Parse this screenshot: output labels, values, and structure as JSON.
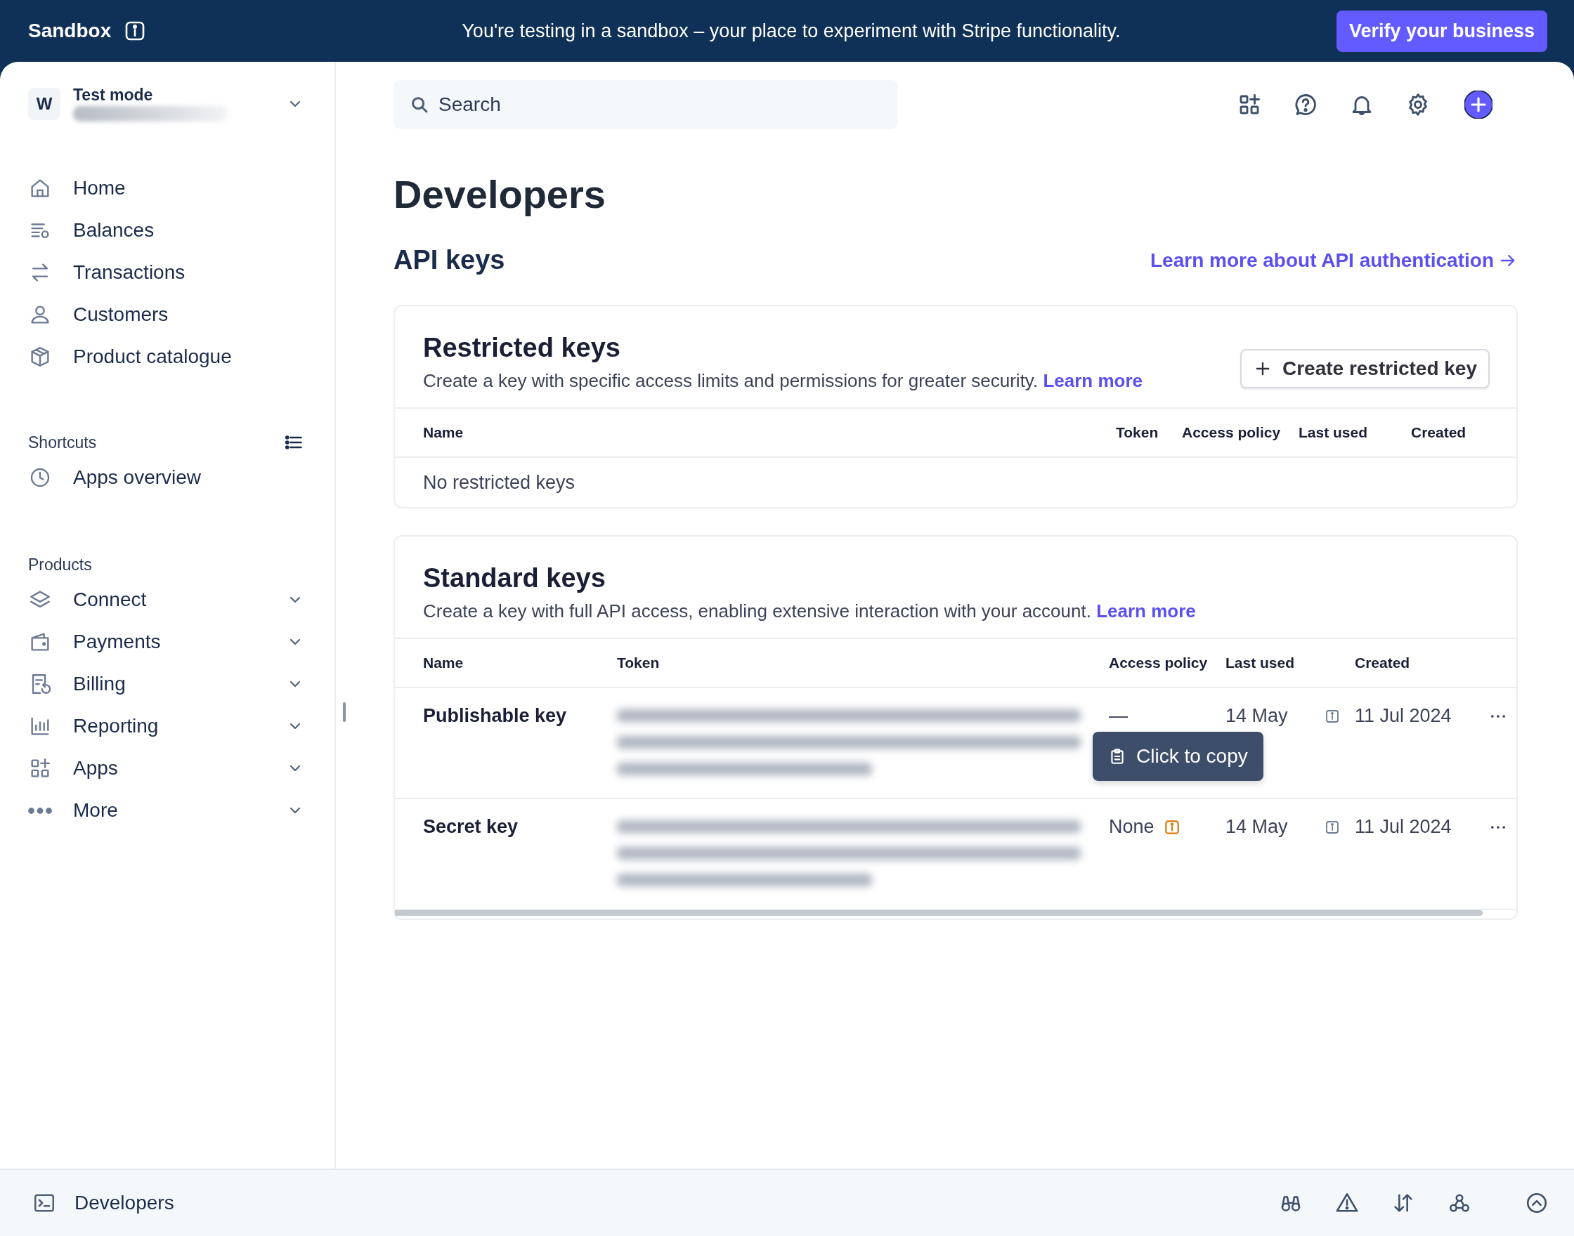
{
  "banner": {
    "label": "Sandbox",
    "message": "You're testing in a sandbox – your place to experiment with Stripe functionality.",
    "button": "Verify your business"
  },
  "account": {
    "avatar": "W",
    "mode": "Test mode"
  },
  "nav": {
    "items": [
      {
        "label": "Home"
      },
      {
        "label": "Balances"
      },
      {
        "label": "Transactions"
      },
      {
        "label": "Customers"
      },
      {
        "label": "Product catalogue"
      }
    ]
  },
  "shortcuts": {
    "heading": "Shortcuts",
    "items": [
      {
        "label": "Apps overview"
      }
    ]
  },
  "products": {
    "heading": "Products",
    "items": [
      {
        "label": "Connect",
        "expanded": false
      },
      {
        "label": "Payments",
        "expanded": false
      },
      {
        "label": "Billing",
        "expanded": false
      },
      {
        "label": "Reporting",
        "expanded": false
      },
      {
        "label": "Apps",
        "expanded": false
      },
      {
        "label": "More",
        "expanded": false
      }
    ]
  },
  "search": {
    "placeholder": "Search"
  },
  "page_title": "Developers",
  "section": {
    "title": "API keys",
    "link": "Learn more about API authentication"
  },
  "restricted": {
    "title": "Restricted keys",
    "description": "Create a key with specific access limits and permissions for greater security.",
    "link": "Learn more",
    "button": "Create restricted key",
    "columns": [
      "Name",
      "Token",
      "Access policy",
      "Last used",
      "Created"
    ],
    "empty_text": "No restricted keys"
  },
  "standard": {
    "title": "Standard keys",
    "description": "Create a key with full API access, enabling extensive interaction with your account.",
    "link": "Learn more",
    "columns": [
      "Name",
      "Token",
      "Access policy",
      "Last used",
      "Created"
    ],
    "rows": [
      {
        "name": "Publishable key",
        "access_policy": "—",
        "policy_warning": false,
        "last_used": "14 May",
        "created": "11 Jul 2024"
      },
      {
        "name": "Secret key",
        "access_policy": "None",
        "policy_warning": true,
        "last_used": "14 May",
        "created": "11 Jul 2024"
      }
    ],
    "tooltip": "Click to copy"
  },
  "footer": {
    "label": "Developers"
  }
}
